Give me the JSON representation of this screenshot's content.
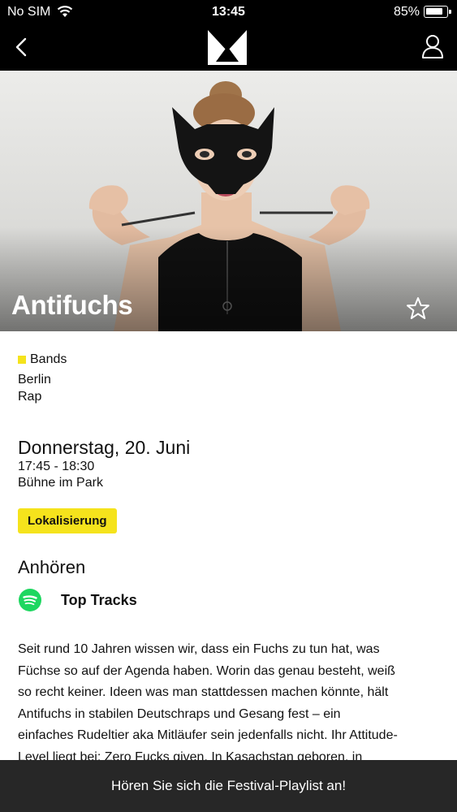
{
  "status_bar": {
    "carrier": "No SIM",
    "time": "13:45",
    "battery": "85%",
    "battery_level": 0.85,
    "wifi_icon": "wifi-icon"
  },
  "nav": {
    "back_icon": "chevron-left-icon",
    "logo_letter": "M",
    "profile_icon": "user-icon"
  },
  "hero": {
    "title": "Antifuchs",
    "favorite_icon": "star-outline-icon"
  },
  "details": {
    "category": "Bands",
    "category_color": "#f5e31c",
    "city": "Berlin",
    "genre": "Rap",
    "date": "Donnerstag, 20. Juni",
    "time": "17:45 - 18:30",
    "stage": "Bühne im Park",
    "location_button": "Lokalisierung"
  },
  "listen": {
    "heading": "Anhören",
    "spotify_icon": "spotify-icon",
    "spotify_color": "#1ed760",
    "top_tracks": "Top Tracks"
  },
  "description": {
    "line1": "Seit rund 10 Jahren wissen wir, dass ein Fuchs zu tun hat, was",
    "line2": "Füchse so auf der Agenda haben. Worin das genau besteht, weiß",
    "line3": "so recht keiner. Ideen was man stattdessen machen könnte, hält",
    "line4": "Antifuchs in stabilen Deutschraps und Gesang fest – ein",
    "line5": "einfaches Rudeltier aka Mitläufer sein jedenfalls nicht. Ihr Attitude-",
    "line6": "Level liegt bei: Zero Fucks given. In Kasachstan geboren, in"
  },
  "bottom_bar": {
    "label": "Hören Sie sich die Festival-Playlist an!"
  }
}
